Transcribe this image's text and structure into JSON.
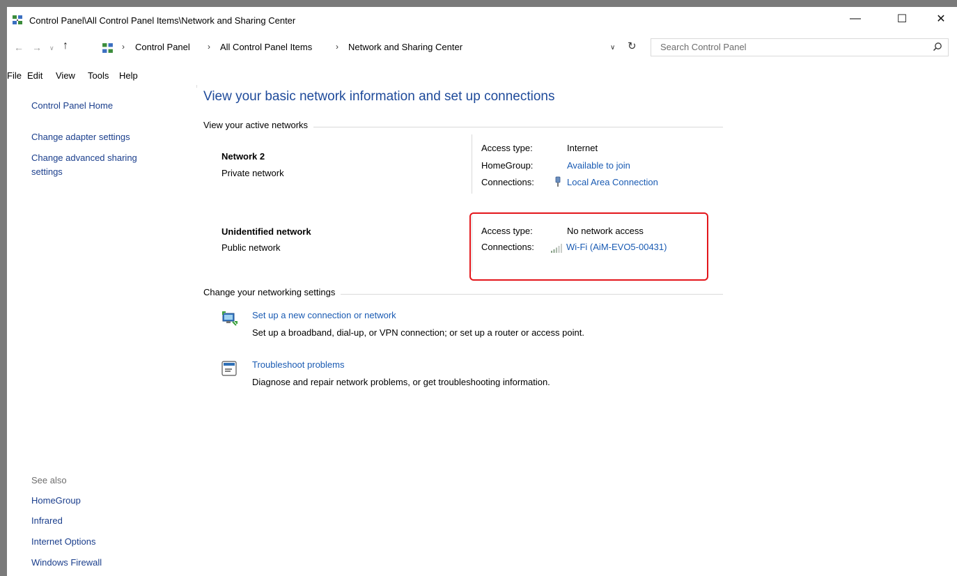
{
  "window": {
    "title": "Control Panel\\All Control Panel Items\\Network and Sharing Center",
    "controls": {
      "minimize": "—",
      "maximize": "☐",
      "close": "✕"
    }
  },
  "address_bar": {
    "breadcrumbs": [
      "Control Panel",
      "All Control Panel Items",
      "Network and Sharing Center"
    ],
    "search_placeholder": "Search Control Panel"
  },
  "menu": [
    "File",
    "Edit",
    "View",
    "Tools",
    "Help"
  ],
  "sidebar": {
    "items": [
      "Control Panel Home",
      "Change adapter settings",
      "Change advanced sharing",
      "settings"
    ],
    "see_also_label": "See also",
    "see_also": [
      "HomeGroup",
      "Infrared",
      "Internet Options",
      "Windows Firewall"
    ]
  },
  "main": {
    "heading": "View your basic network information and set up connections",
    "active_networks_label": "View your active networks",
    "networks": [
      {
        "name": "Network  2",
        "type": "Private network",
        "access_type_label": "Access type:",
        "access_type": "Internet",
        "homegroup_label": "HomeGroup:",
        "homegroup": "Available to join",
        "connections_label": "Connections:",
        "connection": "Local Area Connection",
        "connection_icon": "ethernet-icon"
      },
      {
        "name": "Unidentified network",
        "type": "Public network",
        "access_type_label": "Access type:",
        "access_type": "No network access",
        "connections_label": "Connections:",
        "connection": "Wi-Fi (AiM-EVO5-00431)",
        "connection_icon": "wifi-signal-icon"
      }
    ],
    "settings_label": "Change your networking settings",
    "tasks": [
      {
        "link": "Set up a new connection or network",
        "description": "Set up a broadband, dial-up, or VPN connection; or set up a router or access point.",
        "icon": "new-connection-icon"
      },
      {
        "link": "Troubleshoot problems",
        "description": "Diagnose and repair network problems, or get troubleshooting information.",
        "icon": "troubleshoot-icon"
      }
    ]
  },
  "colors": {
    "link": "#1a5bb3",
    "heading": "#1e4a9a",
    "highlight": "#e3151a"
  }
}
